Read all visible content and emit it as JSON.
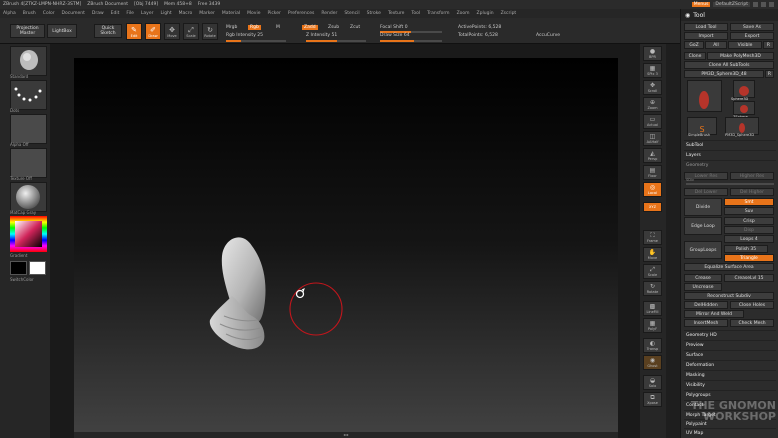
{
  "titlebar": {
    "app": "ZBrush 4[ZTKZ-LMPN-NHRZ-3STM]",
    "doc": "ZBrush Document",
    "stats": "[Obj 7449]",
    "mem": "Mem 458+8",
    "free": "Free 3439",
    "menus_btn": "Menus",
    "script_btn": "DefaultZScript"
  },
  "menubar": [
    "Alpha",
    "Brush",
    "Color",
    "Document",
    "Draw",
    "Edit",
    "File",
    "Layer",
    "Light",
    "Macro",
    "Marker",
    "Material",
    "Movie",
    "Picker",
    "Preferences",
    "Render",
    "Stencil",
    "Stroke",
    "Texture",
    "Tool",
    "Transform",
    "Zoom",
    "Zplugin",
    "Zscript"
  ],
  "toolbar": {
    "projection_master": "Projection Master",
    "lightbox": "LightBox",
    "quick_sketch": "Quick Sketch",
    "edit": "Edit",
    "draw": "Draw",
    "move": "Move",
    "scale": "Scale",
    "rotate": "Rotate",
    "mrgb": "Mrgb",
    "rgb": "Rgb",
    "m": "M",
    "rgb_intensity": "Rgb Intensity 25",
    "zadd": "Zadd",
    "zsub": "Zsub",
    "zcut": "Zcut",
    "z_intensity": "Z Intensity 51",
    "focal_shift": "Focal Shift 0",
    "draw_size": "Draw Size 64",
    "active_points": "ActivePoints: 6,528",
    "total_points": "TotalPoints: 6,528",
    "accucurve": "AccuCurve"
  },
  "leftshelf": {
    "brush": "Standard",
    "stroke": "Dots",
    "alpha": "Alpha Off",
    "texture": "Texture Off",
    "material": "MatCap Gray",
    "gradient": "Gradient",
    "switchcolor": "SwitchColor"
  },
  "rightshelf": [
    "BPR",
    "SPix 3",
    "Scroll",
    "Zoom",
    "Actual",
    "AAHalf",
    "Persp",
    "Floor",
    "Local",
    "XYZ",
    "Frame",
    "Move",
    "Scale",
    "Rotate",
    "LineFill",
    "PolyF",
    "Transp",
    "Ghost",
    "Solo",
    "Xpose"
  ],
  "palette": {
    "title": "Tool",
    "load_tool": "Load Tool",
    "save_as": "Save As",
    "import": "Import",
    "export": "Export",
    "goz": "GoZ",
    "all": "All",
    "visible": "Visible",
    "r": "R",
    "clone": "Clone",
    "make_polymesh": "Make PolyMesh3D",
    "clone_all": "Clone All SubTools",
    "current_tool": "PM3D_Sphere3D_48",
    "r2": "R",
    "subtool_thumbs": [
      "PM3D_Sphere3D",
      "Sphere3D",
      "ZSphere",
      "SimpleBrush",
      "PM3D_Sphere3D"
    ],
    "subtool": "SubTool",
    "layers": "Layers",
    "geometry": "Geometry",
    "lower_res": "Lower Res",
    "higher_res": "Higher Res",
    "sdiv": "SDiv",
    "del_lower": "Del Lower",
    "del_higher": "Del Higher",
    "divide": "Divide",
    "smt": "Smt",
    "suv": "Suv",
    "reuv": "ReUV",
    "edge_loop": "Edge Loop",
    "crisp": "Crisp",
    "disp": "Disp",
    "loops": "Loops 4",
    "grouploops": "GroupLoops",
    "polish": "Polish 35",
    "triangle": "Triangle",
    "equalize": "Equalize Surface Area",
    "crease": "Crease",
    "creaselvl": "CreaseLvl 15",
    "uncrease": "Uncrease",
    "reconstruct": "Reconstruct Subdiv",
    "delhidden": "DelHidden",
    "close_holes": "Close Holes",
    "mirror_weld": "Mirror And Weld",
    "insertmesh": "InsertMesh",
    "check_mesh": "Check Mesh",
    "sections": [
      "Geometry HD",
      "Preview",
      "Surface",
      "Deformation",
      "Masking",
      "Visibility",
      "Polygroups",
      "Contact",
      "Morph Target",
      "Polypaint",
      "UV Map"
    ]
  },
  "canvas": {
    "strip": "◂ ▸"
  },
  "watermark": {
    "line1": "THE GNOMON",
    "line2": "WORKSHOP"
  }
}
